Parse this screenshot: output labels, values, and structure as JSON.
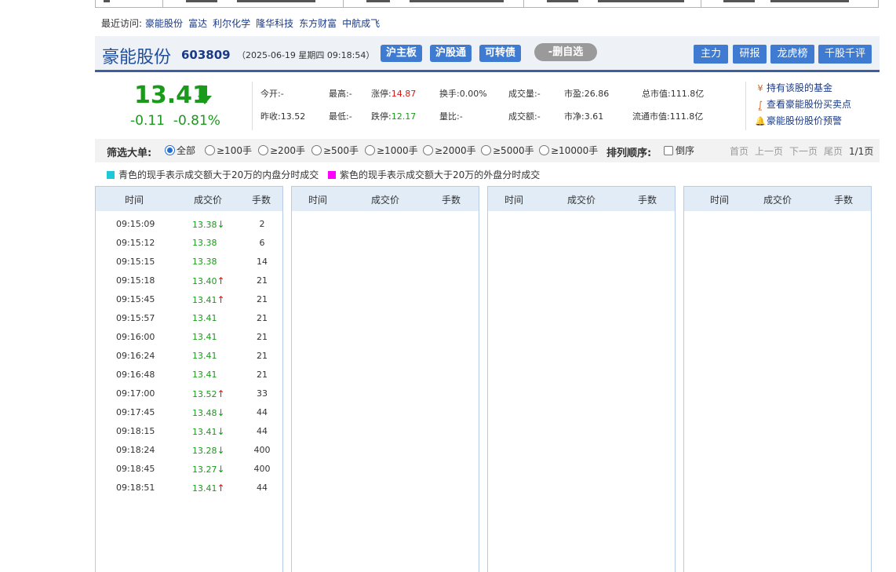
{
  "recent": {
    "label": "最近访问:",
    "items": [
      "豪能股份",
      "富达",
      "利尔化学",
      "隆华科技",
      "东方财富",
      "中航成飞"
    ]
  },
  "header": {
    "name": "豪能股份",
    "code": "603809",
    "datetime": "（2025-06-19 星期四 09:18:54）",
    "tags": [
      "沪主板",
      "沪股通",
      "可转债"
    ],
    "remove_watchlist": "-删自选",
    "buttons": [
      "主力",
      "研报",
      "龙虎榜",
      "千股千评"
    ]
  },
  "quote": {
    "price": "13.41",
    "change": "-0.11",
    "change_pct": "-0.81%",
    "fields": {
      "open": "今开:-",
      "high": "最高:-",
      "limit_up_label": "涨停:",
      "limit_up": "14.87",
      "turnover": "换手:0.00%",
      "volume": "成交量:-",
      "pe": "市盈:26.86",
      "market_cap": "总市值:111.8亿",
      "prev_close": "昨收:13.52",
      "low": "最低:-",
      "limit_down_label": "跌停:",
      "limit_down": "12.17",
      "vol_ratio": "量比:-",
      "amount": "成交额:-",
      "pb": "市净:3.61",
      "float_cap": "流通市值:111.8亿"
    }
  },
  "links": {
    "funds": "持有该股的基金",
    "points": "查看豪能股份买卖点",
    "alert": "豪能股份股价预警"
  },
  "filter": {
    "label": "筛选大单:",
    "options": [
      "全部",
      "≥100手",
      "≥200手",
      "≥500手",
      "≥1000手",
      "≥2000手",
      "≥5000手",
      "≥10000手"
    ],
    "selected": "全部",
    "sort_label": "排列顺序:",
    "reverse_label": "倒序",
    "pager": {
      "first": "首页",
      "prev": "上一页",
      "next": "下一页",
      "last": "尾页",
      "page": "1/1页"
    }
  },
  "legend": {
    "cyan_text": "青色的现手表示成交额大于20万的内盘分时成交",
    "magenta_text": "紫色的现手表示成交额大于20万的外盘分时成交",
    "cyan_color": "#1ec8d8",
    "magenta_color": "#ff00ff"
  },
  "table": {
    "headers": [
      "时间",
      "成交价",
      "手数"
    ],
    "rows": [
      {
        "time": "09:15:09",
        "price": "13.38",
        "dir": "down",
        "vol": "2"
      },
      {
        "time": "09:15:12",
        "price": "13.38",
        "dir": "",
        "vol": "6"
      },
      {
        "time": "09:15:15",
        "price": "13.38",
        "dir": "",
        "vol": "14"
      },
      {
        "time": "09:15:18",
        "price": "13.40",
        "dir": "up",
        "vol": "21"
      },
      {
        "time": "09:15:45",
        "price": "13.41",
        "dir": "up",
        "vol": "21"
      },
      {
        "time": "09:15:57",
        "price": "13.41",
        "dir": "",
        "vol": "21"
      },
      {
        "time": "09:16:00",
        "price": "13.41",
        "dir": "",
        "vol": "21"
      },
      {
        "time": "09:16:24",
        "price": "13.41",
        "dir": "",
        "vol": "21"
      },
      {
        "time": "09:16:48",
        "price": "13.41",
        "dir": "",
        "vol": "21"
      },
      {
        "time": "09:17:00",
        "price": "13.52",
        "dir": "up",
        "vol": "33"
      },
      {
        "time": "09:17:45",
        "price": "13.48",
        "dir": "down",
        "vol": "44"
      },
      {
        "time": "09:18:15",
        "price": "13.41",
        "dir": "down",
        "vol": "44"
      },
      {
        "time": "09:18:24",
        "price": "13.28",
        "dir": "down",
        "vol": "400"
      },
      {
        "time": "09:18:45",
        "price": "13.27",
        "dir": "down",
        "vol": "400"
      },
      {
        "time": "09:18:51",
        "price": "13.41",
        "dir": "up",
        "vol": "44"
      }
    ]
  },
  "colors": {
    "up": "#d01818",
    "down": "#1a9a1a",
    "accent": "#3f7bd0",
    "brand": "#1e4d9c"
  }
}
